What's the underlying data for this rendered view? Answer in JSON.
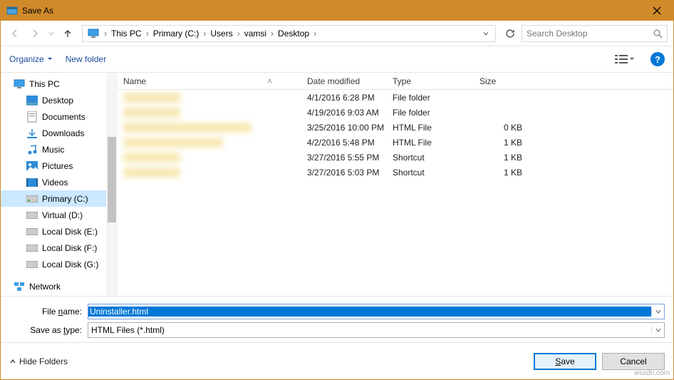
{
  "title": "Save As",
  "breadcrumbs": [
    "This PC",
    "Primary (C:)",
    "Users",
    "vamsi",
    "Desktop"
  ],
  "search_placeholder": "Search Desktop",
  "organize_label": "Organize",
  "newfolder_label": "New folder",
  "columns": {
    "name": "Name",
    "date": "Date modified",
    "type": "Type",
    "size": "Size"
  },
  "sidebar": {
    "root": "This PC",
    "items": [
      {
        "label": "Desktop",
        "icon": "desktop"
      },
      {
        "label": "Documents",
        "icon": "documents"
      },
      {
        "label": "Downloads",
        "icon": "downloads"
      },
      {
        "label": "Music",
        "icon": "music"
      },
      {
        "label": "Pictures",
        "icon": "pictures"
      },
      {
        "label": "Videos",
        "icon": "videos"
      },
      {
        "label": "Primary (C:)",
        "icon": "drive",
        "selected": true
      },
      {
        "label": "Virtual (D:)",
        "icon": "drive"
      },
      {
        "label": "Local Disk (E:)",
        "icon": "drive"
      },
      {
        "label": "Local Disk (F:)",
        "icon": "drive"
      },
      {
        "label": "Local Disk (G:)",
        "icon": "drive"
      }
    ],
    "network": "Network"
  },
  "files": [
    {
      "date": "4/1/2016 6:28 PM",
      "type": "File folder",
      "size": ""
    },
    {
      "date": "4/19/2016 9:03 AM",
      "type": "File folder",
      "size": ""
    },
    {
      "date": "3/25/2016 10:00 PM",
      "type": "HTML File",
      "size": "0 KB"
    },
    {
      "date": "4/2/2016 5:48 PM",
      "type": "HTML File",
      "size": "1 KB"
    },
    {
      "date": "3/27/2016 5:55 PM",
      "type": "Shortcut",
      "size": "1 KB"
    },
    {
      "date": "3/27/2016 5:03 PM",
      "type": "Shortcut",
      "size": "1 KB"
    }
  ],
  "form": {
    "filename_label": "File name:",
    "filename_value": "Uninstaller.html",
    "type_label": "Save as type:",
    "type_value": "HTML Files (*.html)"
  },
  "footer": {
    "hide": "Hide Folders",
    "save": "Save",
    "cancel": "Cancel"
  },
  "watermark": "wsxdn.com"
}
